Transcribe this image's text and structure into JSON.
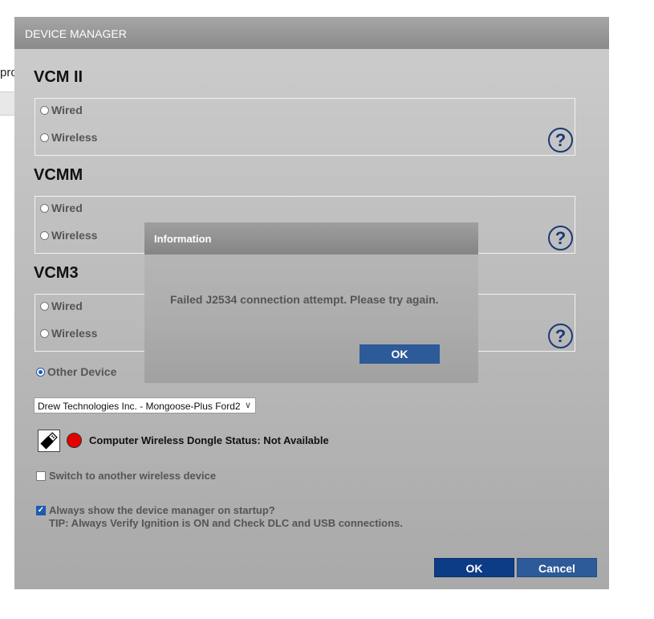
{
  "background": {
    "partial_text": "pro"
  },
  "device_manager": {
    "title": "DEVICE MANAGER",
    "sections": [
      {
        "label": "VCM II",
        "options": [
          "Wired",
          "Wireless"
        ]
      },
      {
        "label": "VCMM",
        "options": [
          "Wired",
          "Wireless"
        ]
      },
      {
        "label": "VCM3",
        "options": [
          "Wired",
          "Wireless"
        ]
      }
    ],
    "help_glyph": "?",
    "other_device_label": "Other Device",
    "other_device_selected": true,
    "device_select_value": "Drew Technologies Inc. - Mongoose-Plus Ford2",
    "dongle_status": "Computer Wireless Dongle Status: Not Available",
    "dongle_status_color": "#e30000",
    "switch_wireless_label": "Switch to another wireless device",
    "switch_wireless_checked": false,
    "always_show_label": "Always show the device manager on startup?",
    "always_show_checked": true,
    "tip": "TIP: Always Verify Ignition is ON and Check DLC and USB connections.",
    "ok_label": "OK",
    "cancel_label": "Cancel"
  },
  "info_dialog": {
    "title": "Information",
    "message": "Failed J2534 connection attempt. Please try again.",
    "ok_label": "OK"
  },
  "colors": {
    "primary_button": "#0c3c86",
    "secondary_button": "#2d5a98",
    "help_icon": "#1a3a78"
  }
}
